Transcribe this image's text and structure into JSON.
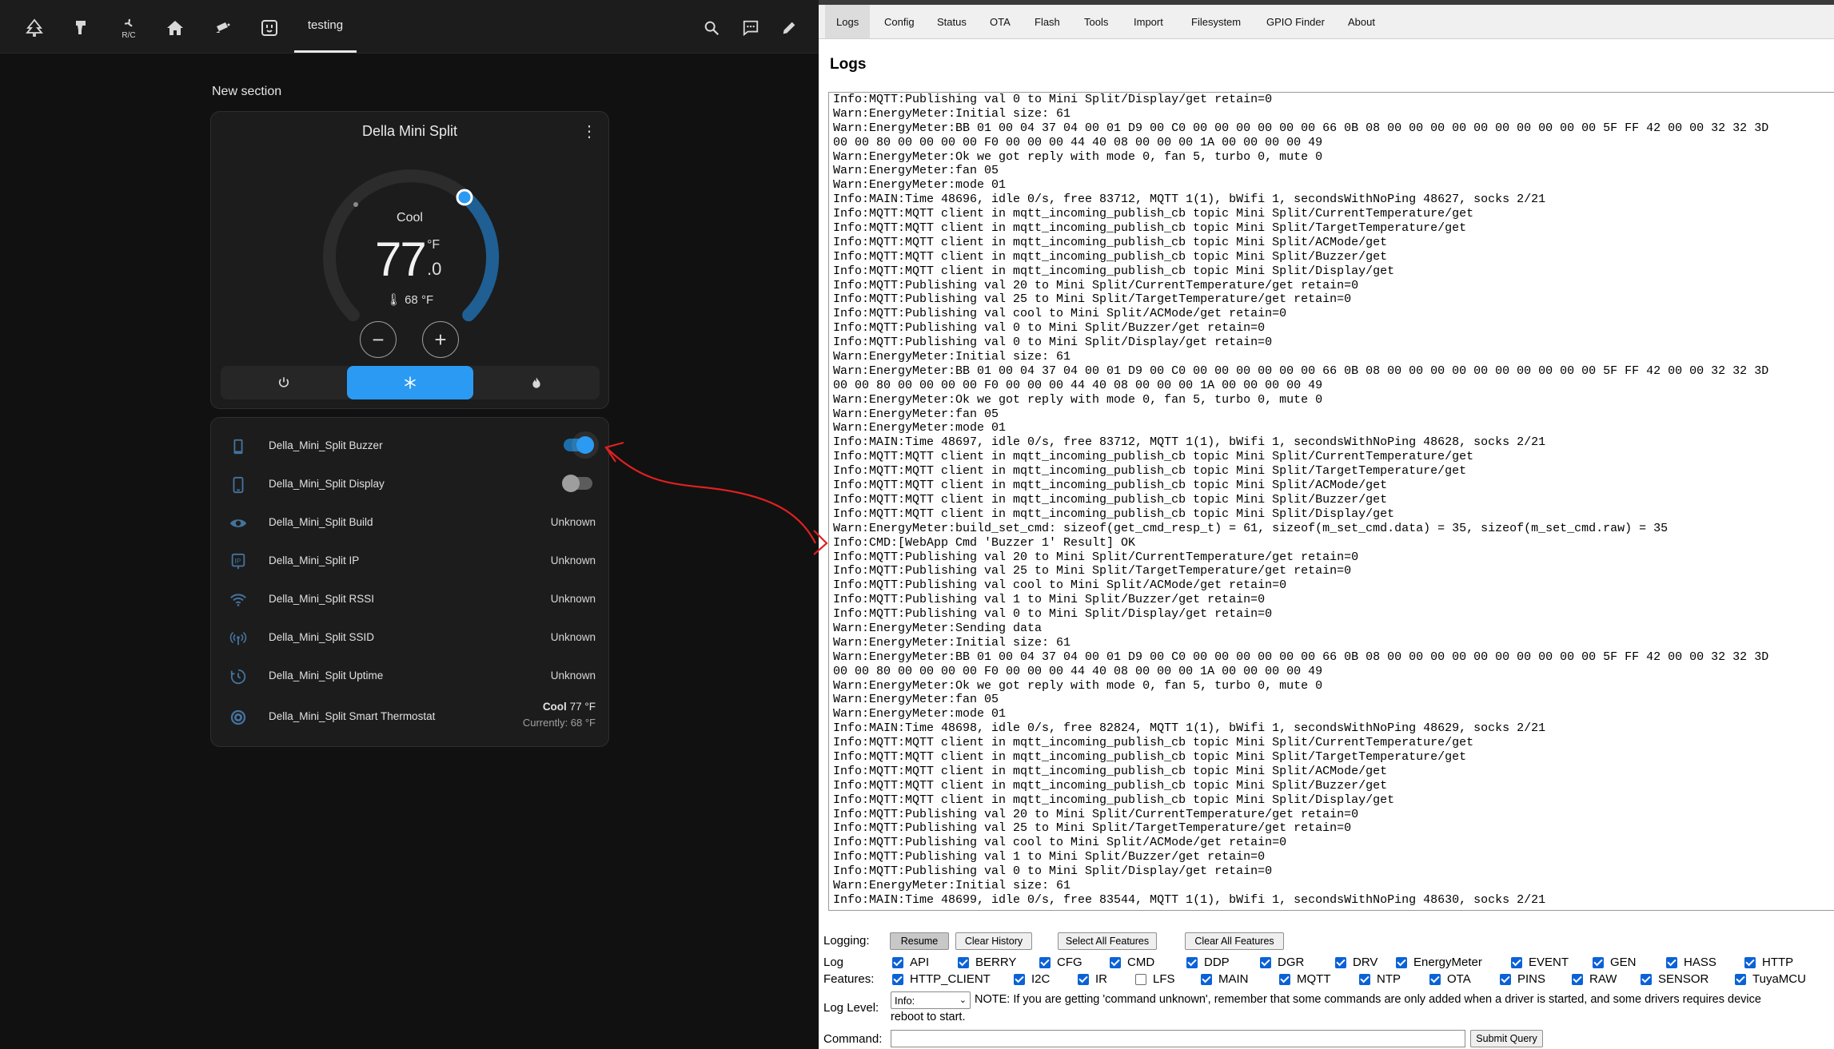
{
  "ha": {
    "nav_icons": [
      "tree-icon",
      "robot-icon",
      "fan-ac-icon",
      "home-icon",
      "camera-icon",
      "outlet-icon"
    ],
    "nav_ac_label": "R/C",
    "active_tab": "testing",
    "section_title": "New section",
    "thermostat": {
      "title": "Della Mini Split",
      "mode": "Cool",
      "target_int": "77",
      "target_unit": "°F",
      "target_dec": ".0",
      "current": "68 °F",
      "accent": "#2b9af3"
    },
    "entities": [
      {
        "name": "Della_Mini_Split Buzzer",
        "icon": "cellphone-icon",
        "type": "toggle",
        "on": true
      },
      {
        "name": "Della_Mini_Split Display",
        "icon": "cellphone-icon",
        "type": "toggle",
        "on": false
      },
      {
        "name": "Della_Mini_Split Build",
        "icon": "eye-icon",
        "state": "Unknown"
      },
      {
        "name": "Della_Mini_Split IP",
        "icon": "ip-icon",
        "state": "Unknown"
      },
      {
        "name": "Della_Mini_Split RSSI",
        "icon": "wifi-icon",
        "state": "Unknown"
      },
      {
        "name": "Della_Mini_Split SSID",
        "icon": "access-point-icon",
        "state": "Unknown"
      },
      {
        "name": "Della_Mini_Split Uptime",
        "icon": "clock-icon",
        "state": "Unknown"
      },
      {
        "name": "Della_Mini_Split Smart Thermostat",
        "icon": "thermostat-icon",
        "state_bold": "Cool",
        "state_value": "77 °F",
        "state_sub": "Currently: 68 °F"
      }
    ]
  },
  "app": {
    "tabs": [
      "Logs",
      "Config",
      "Status",
      "OTA",
      "Flash",
      "Tools",
      "Import",
      "Filesystem",
      "GPIO Finder",
      "About"
    ],
    "heading": "Logs",
    "log_lines": [
      "Info:MQTT:Publishing val 0 to Mini Split/Display/get retain=0",
      "Warn:EnergyMeter:Initial size: 61",
      "Warn:EnergyMeter:BB 01 00 04 37 04 00 01 D9 00 C0 00 00 00 00 00 00 66 0B 08 00 00 00 00 00 00 00 00 00 00 5F FF 42 00 00 32 32 3D",
      "00 00 80 00 00 00 00 F0 00 00 00 44 40 08 00 00 00 1A 00 00 00 00 49",
      "Warn:EnergyMeter:Ok we got reply with mode 0, fan 5, turbo 0, mute 0",
      "Warn:EnergyMeter:fan 05",
      "Warn:EnergyMeter:mode 01",
      "Info:MAIN:Time 48696, idle 0/s, free 83712, MQTT 1(1), bWifi 1, secondsWithNoPing 48627, socks 2/21",
      "Info:MQTT:MQTT client in mqtt_incoming_publish_cb topic Mini Split/CurrentTemperature/get",
      "Info:MQTT:MQTT client in mqtt_incoming_publish_cb topic Mini Split/TargetTemperature/get",
      "Info:MQTT:MQTT client in mqtt_incoming_publish_cb topic Mini Split/ACMode/get",
      "Info:MQTT:MQTT client in mqtt_incoming_publish_cb topic Mini Split/Buzzer/get",
      "Info:MQTT:MQTT client in mqtt_incoming_publish_cb topic Mini Split/Display/get",
      "Info:MQTT:Publishing val 20 to Mini Split/CurrentTemperature/get retain=0",
      "Info:MQTT:Publishing val 25 to Mini Split/TargetTemperature/get retain=0",
      "Info:MQTT:Publishing val cool to Mini Split/ACMode/get retain=0",
      "Info:MQTT:Publishing val 0 to Mini Split/Buzzer/get retain=0",
      "Info:MQTT:Publishing val 0 to Mini Split/Display/get retain=0",
      "Warn:EnergyMeter:Initial size: 61",
      "Warn:EnergyMeter:BB 01 00 04 37 04 00 01 D9 00 C0 00 00 00 00 00 00 66 0B 08 00 00 00 00 00 00 00 00 00 00 5F FF 42 00 00 32 32 3D",
      "00 00 80 00 00 00 00 F0 00 00 00 44 40 08 00 00 00 1A 00 00 00 00 49",
      "Warn:EnergyMeter:Ok we got reply with mode 0, fan 5, turbo 0, mute 0",
      "Warn:EnergyMeter:fan 05",
      "Warn:EnergyMeter:mode 01",
      "Info:MAIN:Time 48697, idle 0/s, free 83712, MQTT 1(1), bWifi 1, secondsWithNoPing 48628, socks 2/21",
      "Info:MQTT:MQTT client in mqtt_incoming_publish_cb topic Mini Split/CurrentTemperature/get",
      "Info:MQTT:MQTT client in mqtt_incoming_publish_cb topic Mini Split/TargetTemperature/get",
      "Info:MQTT:MQTT client in mqtt_incoming_publish_cb topic Mini Split/ACMode/get",
      "Info:MQTT:MQTT client in mqtt_incoming_publish_cb topic Mini Split/Buzzer/get",
      "Info:MQTT:MQTT client in mqtt_incoming_publish_cb topic Mini Split/Display/get",
      "Warn:EnergyMeter:build_set_cmd: sizeof(get_cmd_resp_t) = 61, sizeof(m_set_cmd.data) = 35, sizeof(m_set_cmd.raw) = 35",
      "Info:CMD:[WebApp Cmd 'Buzzer 1' Result] OK",
      "Info:MQTT:Publishing val 20 to Mini Split/CurrentTemperature/get retain=0",
      "Info:MQTT:Publishing val 25 to Mini Split/TargetTemperature/get retain=0",
      "Info:MQTT:Publishing val cool to Mini Split/ACMode/get retain=0",
      "Info:MQTT:Publishing val 1 to Mini Split/Buzzer/get retain=0",
      "Info:MQTT:Publishing val 0 to Mini Split/Display/get retain=0",
      "Warn:EnergyMeter:Sending data",
      "Warn:EnergyMeter:Initial size: 61",
      "Warn:EnergyMeter:BB 01 00 04 37 04 00 01 D9 00 C0 00 00 00 00 00 00 66 0B 08 00 00 00 00 00 00 00 00 00 00 5F FF 42 00 00 32 32 3D",
      "00 00 80 00 00 00 00 F0 00 00 00 44 40 08 00 00 00 1A 00 00 00 00 49",
      "Warn:EnergyMeter:Ok we got reply with mode 0, fan 5, turbo 0, mute 0",
      "Warn:EnergyMeter:fan 05",
      "Warn:EnergyMeter:mode 01",
      "Info:MAIN:Time 48698, idle 0/s, free 82824, MQTT 1(1), bWifi 1, secondsWithNoPing 48629, socks 2/21",
      "Info:MQTT:MQTT client in mqtt_incoming_publish_cb topic Mini Split/CurrentTemperature/get",
      "Info:MQTT:MQTT client in mqtt_incoming_publish_cb topic Mini Split/TargetTemperature/get",
      "Info:MQTT:MQTT client in mqtt_incoming_publish_cb topic Mini Split/ACMode/get",
      "Info:MQTT:MQTT client in mqtt_incoming_publish_cb topic Mini Split/Buzzer/get",
      "Info:MQTT:MQTT client in mqtt_incoming_publish_cb topic Mini Split/Display/get",
      "Info:MQTT:Publishing val 20 to Mini Split/CurrentTemperature/get retain=0",
      "Info:MQTT:Publishing val 25 to Mini Split/TargetTemperature/get retain=0",
      "Info:MQTT:Publishing val cool to Mini Split/ACMode/get retain=0",
      "Info:MQTT:Publishing val 1 to Mini Split/Buzzer/get retain=0",
      "Info:MQTT:Publishing val 0 to Mini Split/Display/get retain=0",
      "Warn:EnergyMeter:Initial size: 61",
      "Info:MAIN:Time 48699, idle 0/s, free 83544, MQTT 1(1), bWifi 1, secondsWithNoPing 48630, socks 2/21"
    ],
    "logging_label": "Logging:",
    "buttons": {
      "resume": "Resume",
      "clear_history": "Clear History",
      "select_all": "Select All Features",
      "clear_all": "Clear All Features"
    },
    "log_features_label_1": "Log",
    "log_features_label_2": "Features:",
    "features_row1": [
      {
        "label": "API",
        "checked": true
      },
      {
        "label": "BERRY",
        "checked": true
      },
      {
        "label": "CFG",
        "checked": true
      },
      {
        "label": "CMD",
        "checked": true
      },
      {
        "label": "DDP",
        "checked": true
      },
      {
        "label": "DGR",
        "checked": true
      },
      {
        "label": "DRV",
        "checked": true
      },
      {
        "label": "EnergyMeter",
        "checked": true
      },
      {
        "label": "EVENT",
        "checked": true
      },
      {
        "label": "GEN",
        "checked": true
      },
      {
        "label": "HASS",
        "checked": true
      },
      {
        "label": "HTTP",
        "checked": true
      }
    ],
    "features_row2": [
      {
        "label": "HTTP_CLIENT",
        "checked": true
      },
      {
        "label": "I2C",
        "checked": true
      },
      {
        "label": "IR",
        "checked": true
      },
      {
        "label": "LFS",
        "checked": false
      },
      {
        "label": "MAIN",
        "checked": true
      },
      {
        "label": "MQTT",
        "checked": true
      },
      {
        "label": "NTP",
        "checked": true
      },
      {
        "label": "OTA",
        "checked": true
      },
      {
        "label": "PINS",
        "checked": true
      },
      {
        "label": "RAW",
        "checked": true
      },
      {
        "label": "SENSOR",
        "checked": true
      },
      {
        "label": "TuyaMCU",
        "checked": true
      }
    ],
    "log_level_label": "Log Level:",
    "log_level_value": "Info:",
    "log_level_note": "NOTE: If you are getting 'command unknown', remember that some commands are only added when a driver is started, and some drivers requires device",
    "log_level_note2": "reboot to start.",
    "command_label": "Command:",
    "submit_label": "Submit Query"
  }
}
